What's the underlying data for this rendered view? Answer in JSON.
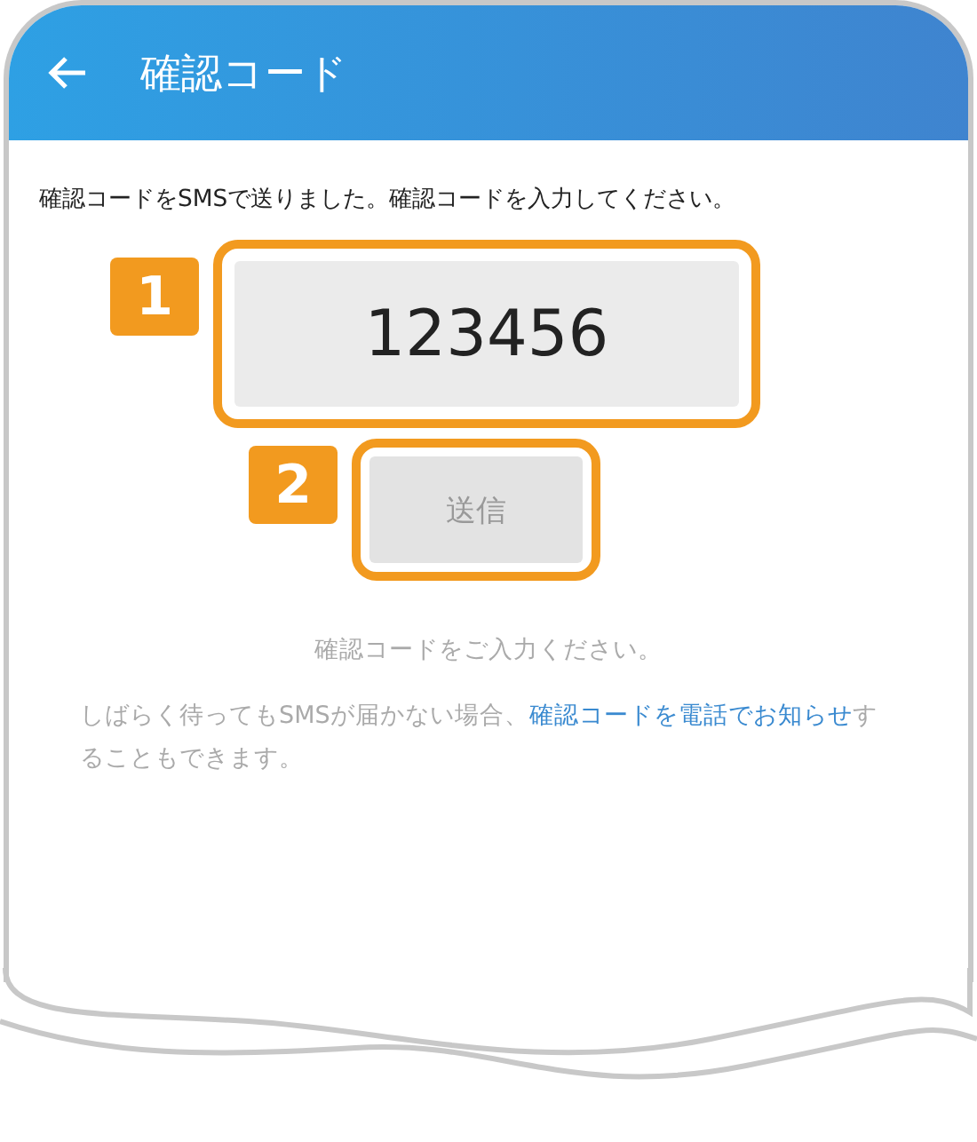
{
  "header": {
    "title": "確認コード"
  },
  "instruction": "確認コードをSMSで送りました。確認コードを入力してください。",
  "code_field": {
    "value": "123456",
    "callout": "1"
  },
  "send_button": {
    "label": "送信",
    "disabled": true,
    "callout": "2"
  },
  "hint": "確認コードをご入力ください。",
  "notice": {
    "before": "しばらく待ってもSMSが届かない場合、",
    "link": "確認コードを電話でお知らせ",
    "after": "することもできます。"
  }
}
